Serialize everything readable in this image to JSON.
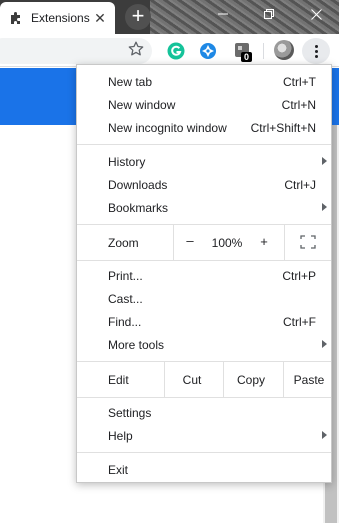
{
  "tab": {
    "title": "Extensions",
    "icon": "puzzle-icon"
  },
  "toolbar": {
    "extensions": [
      {
        "name": "grammarly-icon",
        "color": "#15c39a"
      },
      {
        "name": "blue-extension-icon",
        "color": "#1e88e5"
      },
      {
        "name": "gray-extension-icon",
        "color": "#6b6b6b",
        "badge": "0"
      }
    ]
  },
  "colors": {
    "page_banner": "#1a73e8",
    "menu_bg": "#ffffff",
    "titlebar": "#3c3c3c"
  },
  "menu": {
    "new_tab": {
      "label": "New tab",
      "shortcut": "Ctrl+T"
    },
    "new_window": {
      "label": "New window",
      "shortcut": "Ctrl+N"
    },
    "new_incognito": {
      "label": "New incognito window",
      "shortcut": "Ctrl+Shift+N"
    },
    "history": {
      "label": "History"
    },
    "downloads": {
      "label": "Downloads",
      "shortcut": "Ctrl+J"
    },
    "bookmarks": {
      "label": "Bookmarks"
    },
    "zoom": {
      "label": "Zoom",
      "minus": "–",
      "level": "100%",
      "plus": "+"
    },
    "print": {
      "label": "Print...",
      "shortcut": "Ctrl+P"
    },
    "cast": {
      "label": "Cast..."
    },
    "find": {
      "label": "Find...",
      "shortcut": "Ctrl+F"
    },
    "more_tools": {
      "label": "More tools"
    },
    "edit": {
      "label": "Edit",
      "cut": "Cut",
      "copy": "Copy",
      "paste": "Paste"
    },
    "settings": {
      "label": "Settings"
    },
    "help": {
      "label": "Help"
    },
    "exit": {
      "label": "Exit"
    }
  }
}
